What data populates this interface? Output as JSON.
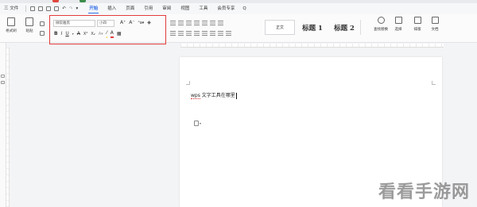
{
  "menubar": {
    "file": "三 文件",
    "tabs": [
      {
        "label": "开始",
        "active": true
      },
      {
        "label": "插入",
        "active": false
      },
      {
        "label": "页面",
        "active": false
      },
      {
        "label": "引用",
        "active": false
      },
      {
        "label": "审阅",
        "active": false
      },
      {
        "label": "视图",
        "active": false
      },
      {
        "label": "工具",
        "active": false
      },
      {
        "label": "会员专享",
        "active": false
      }
    ],
    "search_icon": "search-icon",
    "search_label": "Q"
  },
  "ribbon": {
    "format_painter": "格式刷",
    "paste": "粘贴",
    "font_name": "微软雅黑",
    "font_size": "小四",
    "bold": "B",
    "italic": "I",
    "underline": "U",
    "styles": {
      "body": "正文",
      "heading1": "标题 1",
      "heading2": "标题 2"
    },
    "find_replace": "查找替换",
    "select": "选择",
    "layout": "排版",
    "document_assist": "文档"
  },
  "document": {
    "text_prefix": "wps",
    "text_rest": " 文字工具在哪里"
  },
  "watermark": "看看手游网",
  "colors": {
    "accent": "#2f6ee5",
    "highlight_box": "#e23b3b"
  }
}
